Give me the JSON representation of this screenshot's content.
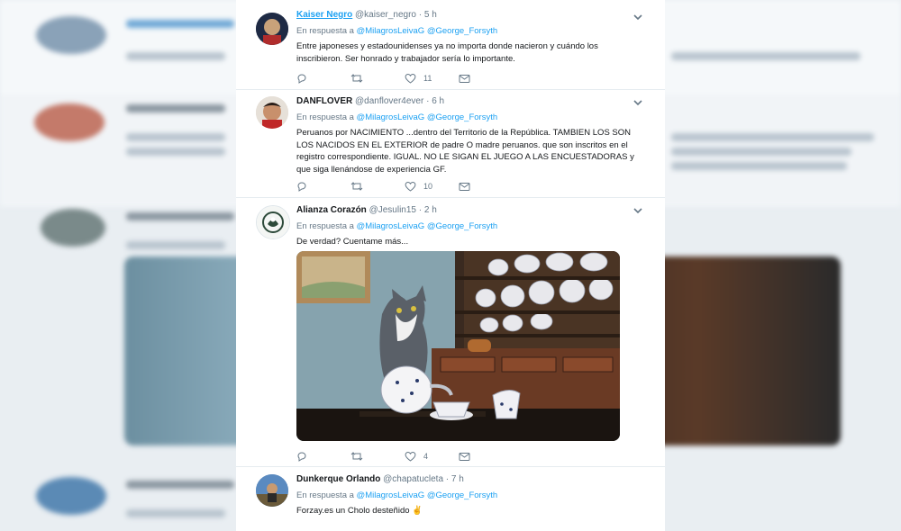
{
  "tweets": [
    {
      "name": "Kaiser Negro",
      "handle": "@kaiser_negro",
      "time": "· 5 h",
      "reply_prefix": "En respuesta a",
      "mention1": "@MilagrosLeivaG",
      "mention2": "@George_Forsyth",
      "text": "Entre japoneses y estadounidenses ya no importa donde nacieron y cuándo los inscribieron. Ser honrado y trabajador sería lo importante.",
      "likes": "11"
    },
    {
      "name": "DANFLOVER",
      "handle": "@danflover4ever",
      "time": "· 6 h",
      "reply_prefix": "En respuesta a",
      "mention1": "@MilagrosLeivaG",
      "mention2": "@George_Forsyth",
      "text": "Peruanos por NACIMIENTO ...dentro del Territorio de la República. TAMBIEN LOS SON LOS NACIDOS EN EL EXTERIOR de padre O madre  peruanos. que son inscritos en el registro correspondiente. IGUAL. NO LE SIGAN EL JUEGO A LAS ENCUESTADORAS y que siga llenándose de experiencia GF.",
      "likes": "10"
    },
    {
      "name": "Alianza Corazón",
      "handle": "@Jesulin15",
      "time": "· 2 h",
      "reply_prefix": "En respuesta a",
      "mention1": "@MilagrosLeivaG",
      "mention2": "@George_Forsyth",
      "text": "De verdad? Cuentame más...",
      "likes": "4"
    },
    {
      "name": "Dunkerque Orlando",
      "handle": "@chapatucleta",
      "time": "· 7 h",
      "reply_prefix": "En respuesta a",
      "mention1": "@MilagrosLeivaG",
      "mention2": "@George_Forsyth",
      "text": "Forzay.es un Cholo desteñido ✌"
    }
  ],
  "icons": [
    "reply-icon",
    "retweet-icon",
    "like-icon",
    "dm-icon",
    "chevron-down-icon"
  ],
  "colors": {
    "accent": "#1da1f2",
    "secondary_text": "#657786"
  }
}
